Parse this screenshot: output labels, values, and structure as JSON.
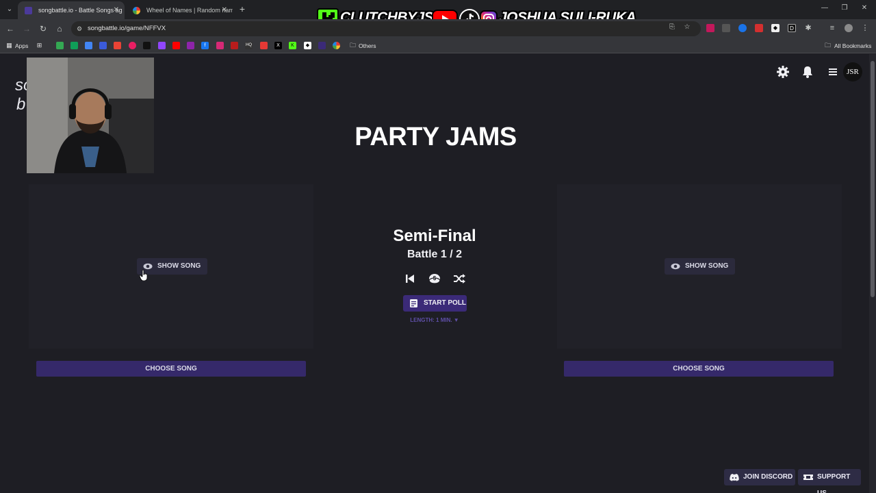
{
  "browser": {
    "tabs": [
      {
        "title": "songbattle.io - Battle Songs ag",
        "active": true
      },
      {
        "title": "Wheel of Names | Random nam",
        "active": false
      }
    ],
    "url": "songbattle.io/game/NFFVX",
    "bookmarks": {
      "apps_label": "Apps",
      "others_label": "Others",
      "all_bookmarks_label": "All Bookmarks"
    }
  },
  "overlay": {
    "kick_handle": "CLUTCHBYJSR",
    "social_handle": "JOSHUA SULI-RUKA",
    "colors": {
      "kick": "#53fc18",
      "youtube": "#ff0000",
      "tiktok": "#111111",
      "instagram": "#d62976"
    }
  },
  "site": {
    "logo_partial": [
      "so",
      "b"
    ],
    "avatar_initials": "JSR",
    "accent": "#35296a"
  },
  "game": {
    "title": "PARTY JAMS",
    "round": "Semi-Final",
    "battle": "Battle 1 / 2",
    "start_poll_label": "START POLL",
    "length_label": "LENGTH: 1 MIN. ▼",
    "left": {
      "show_song_label": "SHOW SONG",
      "choose_song_label": "CHOOSE SONG"
    },
    "right": {
      "show_song_label": "SHOW SONG",
      "choose_song_label": "CHOOSE SONG"
    }
  },
  "footer": {
    "discord_label": "JOIN DISCORD",
    "support_label": "SUPPORT US"
  }
}
